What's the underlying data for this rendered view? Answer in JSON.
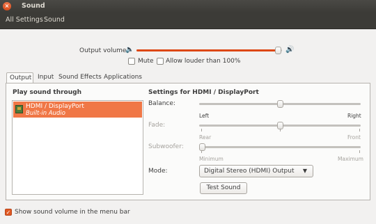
{
  "window": {
    "title": "Sound"
  },
  "toolbar": {
    "crumbs": [
      "All Settings",
      "Sound"
    ]
  },
  "output_volume": {
    "label": "Output volume:",
    "level": 0.97,
    "mute_label": "Mute",
    "mute_checked": false,
    "allow_louder_label": "Allow louder than 100%",
    "allow_louder_checked": false
  },
  "tabs": [
    "Output",
    "Input",
    "Sound Effects",
    "Applications"
  ],
  "active_tab": "Output",
  "output": {
    "play_through_label": "Play sound through",
    "devices": [
      {
        "name": "HDMI / DisplayPort",
        "subtitle": "Built-in Audio",
        "selected": true
      }
    ],
    "settings_title": "Settings for HDMI / DisplayPort",
    "balance": {
      "label": "Balance:",
      "left": "Left",
      "right": "Right",
      "value": 0.5
    },
    "fade": {
      "label": "Fade:",
      "rear": "Rear",
      "front": "Front",
      "value": 0.5
    },
    "subwoofer": {
      "label": "Subwoofer:",
      "min": "Minimum",
      "max": "Maximum",
      "value": 0.0
    },
    "mode": {
      "label": "Mode:",
      "value": "Digital Stereo (HDMI) Output"
    },
    "test_button": "Test Sound"
  },
  "footer": {
    "show_volume_label": "Show sound volume in the menu bar",
    "show_volume_checked": true
  },
  "colors": {
    "accent": "#dd4814",
    "selection": "#f07746",
    "titlebar": "#3c3b37"
  }
}
